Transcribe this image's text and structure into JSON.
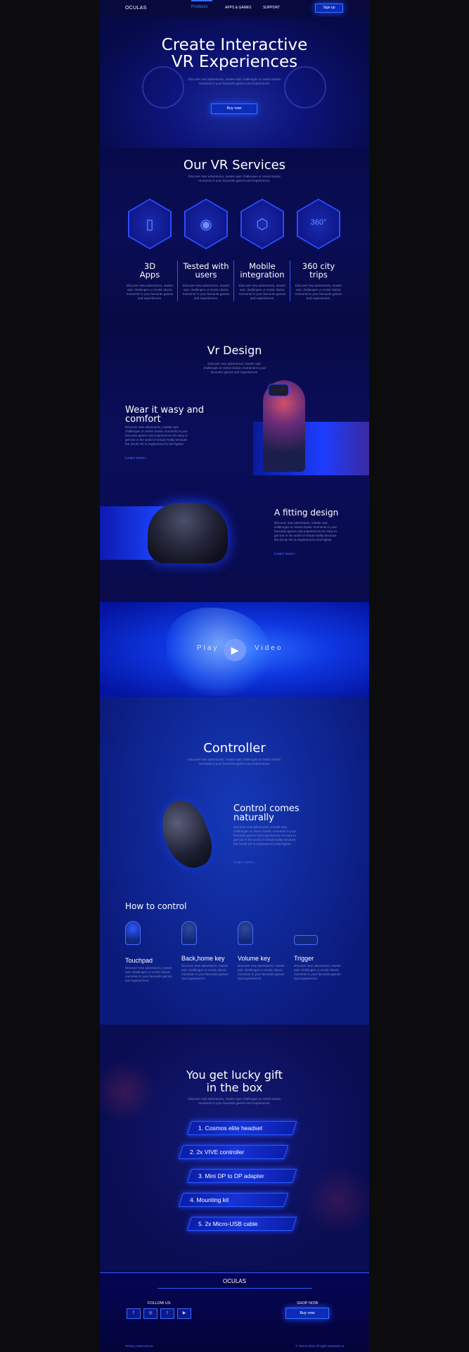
{
  "nav": {
    "logo": "OCULAS",
    "items": [
      "Products",
      "APPS & GAMES",
      "SUPPORT"
    ],
    "signup": "Sign up"
  },
  "hero": {
    "title_line1": "Create Interactive",
    "title_line2": "VR Experiences",
    "subtitle_line1": "Discover new adventures, master epic challenges or revisit classic",
    "subtitle_line2": "moments in your favourite games and experiences.",
    "cta": "Buy now"
  },
  "services": {
    "title": "Our VR Services",
    "subtitle_line1": "Discover new adventures, master epic challenges or revisit classic",
    "subtitle_line2": "moments in your favourite games and experiences.",
    "items": [
      {
        "icon": "phone-vr-icon",
        "title_line1": "3D",
        "title_line2": "Apps",
        "text": "Discover new adventures, master epic challenges or revisit classic moments in your favourite games and experiences."
      },
      {
        "icon": "headset-user-icon",
        "title_line1": "Tested with",
        "title_line2": "users",
        "text": "Discover new adventures, master epic challenges or revisit classic moments in your favourite games and experiences."
      },
      {
        "icon": "cube-rotate-icon",
        "title_line1": "Mobile",
        "title_line2": "integration",
        "text": "Discover new adventures, master epic challenges or revisit classic moments in your favourite games and experiences."
      },
      {
        "icon": "360-image-icon",
        "title_line1": "360 city",
        "title_line2": "trips",
        "text": "Discover new adventures, master epic challenges or revisit classic moments in your favourite games and experiences."
      }
    ]
  },
  "design": {
    "title": "Vr Design",
    "subtitle": "Discover new adventures, master epic challenges or revisit classic moments in your favourite games and experiences.",
    "block1": {
      "title_line1": "Wear it wasy and",
      "title_line2": "comfort",
      "text": "Discover new adventures, master epic challenges or revisit classic moments in your favourite games and experiences.It's easy to get lost in the world of virtual reality because the Oculs VR is engineered for feel lighter.",
      "link": "Learn more"
    },
    "block2": {
      "title": "A fitting design",
      "text": "Discover new adventures, master epic challenges or revisit classic moments in your favourite games and experiences.It's easy to get lost in the world of virtual reality because the Oculs VR is engineered to feel lighter.",
      "link": "Learn more"
    }
  },
  "video": {
    "play_left": "Play",
    "play_right": "Video"
  },
  "controller": {
    "title": "Controller",
    "subtitle_line1": "Discover new adventures, master epic challenges or revisit classic",
    "subtitle_line2": "moments in your favourite games and experiences.",
    "block": {
      "title_line1": "Control comes",
      "title_line2": "naturally",
      "text": "Discover new adventures, master epic challenges or revisit classic moments in your favourite games and experiences.It's easy to get lost in the world of virtual reality because the Oculs VR is engineered to feel lighter.",
      "link": "Learn more"
    },
    "how_title": "How to control",
    "keys": [
      {
        "icon": "touchpad-icon",
        "title": "Touchpad",
        "text": "Discover new adventures, master epic challenges or revisit classic moments in your favourite games and experiences."
      },
      {
        "icon": "home-key-icon",
        "title": "Back,home key",
        "text": "Discover new adventures, master epic challenges or revisit classic moments in your favourite games and experiences."
      },
      {
        "icon": "volume-key-icon",
        "title": "Volume key",
        "text": "Discover new adventures, master epic challenges or revisit classic moments in your favourite games and experiences."
      },
      {
        "icon": "trigger-icon",
        "title": "Trigger",
        "text": "Discover new adventures, master epic challenges or revisit classic moments in your favourite games and experiences."
      }
    ]
  },
  "gift": {
    "title_line1": "You get lucky gift",
    "title_line2": "in the box",
    "subtitle_line1": "Discover new adventures, master epic challenges or revisit classic",
    "subtitle_line2": "moments in your favourite games and experiences.",
    "items": [
      "1.  Cosmos elite headset",
      "2.  2x VIVE controller",
      "3.  Mini DP to DP adapter",
      "4.  Mounting kit",
      "5.  2x Micro-USB cable"
    ]
  },
  "footer": {
    "logo": "OCULAS",
    "follow": "FOLLOW US",
    "shop": "SHOP NOW",
    "buy": "Buy now",
    "social": [
      "f",
      "◎",
      "t",
      "▶"
    ],
    "privacy": "Privacy reserved us",
    "copyright": "© Terms 2021 All right reserved us"
  },
  "colors": {
    "accent": "#3d6bff",
    "bg": "#07083a",
    "outer": "#0c0c0e"
  }
}
